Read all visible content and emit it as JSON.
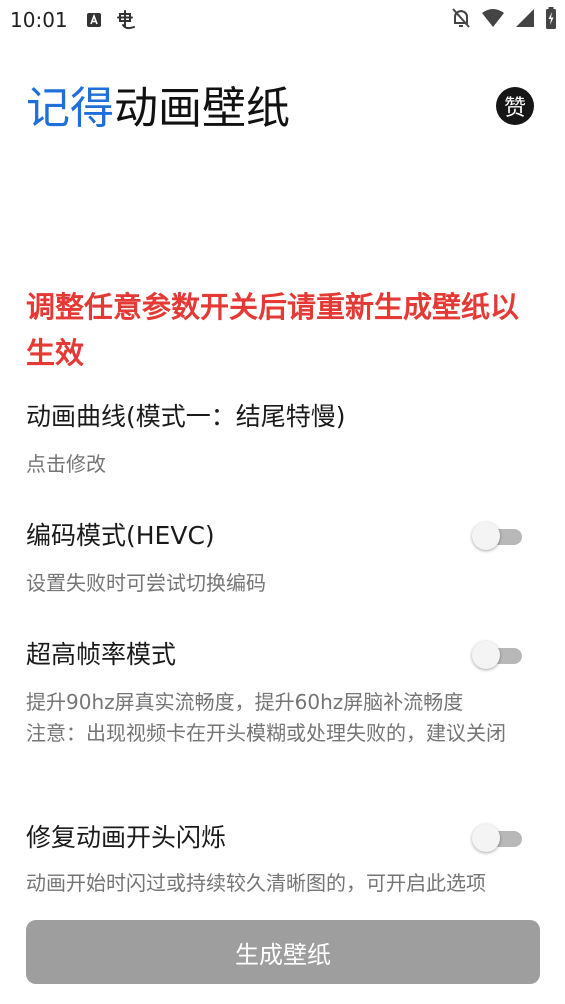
{
  "status_bar": {
    "time": "10:01",
    "left_icons": [
      "text-a-icon",
      "chinese-char-icon"
    ],
    "right_icons": [
      "bell-off-icon",
      "wifi-icon",
      "signal-icon",
      "battery-charging-icon"
    ]
  },
  "header": {
    "title_brand": "记得",
    "title_rest": "动画壁纸",
    "like_label": "赞"
  },
  "warning": "调整任意参数开关后请重新生成壁纸以生效",
  "settings": [
    {
      "title": "动画曲线(模式一：结尾特慢)",
      "summary": [
        "点击修改"
      ],
      "has_switch": false
    },
    {
      "title": "编码模式(HEVC)",
      "summary": [
        "设置失败时可尝试切换编码"
      ],
      "has_switch": true,
      "checked": false
    },
    {
      "title": "超高帧率模式",
      "summary": [
        "提升90hz屏真实流畅度，提升60hz屏脑补流畅度",
        "注意：出现视频卡在开头模糊或处理失败的，建议关闭"
      ],
      "has_switch": true,
      "checked": false
    },
    {
      "title": "修复动画开头闪烁",
      "summary": [
        "动画开始时闪过或持续较久清晰图的，可开启此选项"
      ],
      "has_switch": true,
      "checked": false
    }
  ],
  "generate_button": "生成壁纸",
  "colors": {
    "brand_blue": "#1e6fd9",
    "warning_red": "#e53935",
    "button_disabled": "#9e9e9e"
  }
}
